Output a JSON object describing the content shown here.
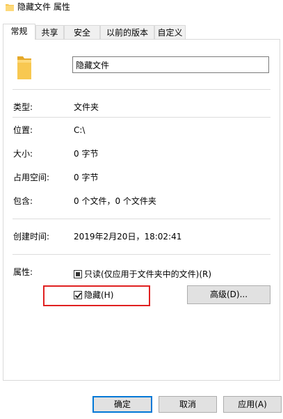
{
  "window": {
    "title": "隐藏文件 属性",
    "icon": "folder-icon",
    "folder_color": "#f8c851"
  },
  "tabs": [
    {
      "label": "常规",
      "active": true
    },
    {
      "label": "共享",
      "active": false
    },
    {
      "label": "安全",
      "active": false
    },
    {
      "label": "以前的版本",
      "active": false
    },
    {
      "label": "自定义",
      "active": false
    }
  ],
  "general": {
    "name_value": "隐藏文件",
    "type_label": "类型:",
    "type_value": "文件夹",
    "location_label": "位置:",
    "location_value": "C:\\",
    "size_label": "大小:",
    "size_value": "0 字节",
    "size_on_disk_label": "占用空间:",
    "size_on_disk_value": "0 字节",
    "contains_label": "包含:",
    "contains_value": "0 个文件，0 个文件夹",
    "created_label": "创建时间:",
    "created_value": "2019年2月20日，18:02:41",
    "attributes_label": "属性:",
    "readonly_label": "只读(仅应用于文件夹中的文件)(R)",
    "readonly_state": "indeterminate",
    "hidden_label": "隐藏(H)",
    "hidden_checked": true,
    "advanced_label": "高级(D)..."
  },
  "buttons": {
    "ok": "确定",
    "cancel": "取消",
    "apply": "应用(A)"
  },
  "accent_color": "#0078d7",
  "highlight_color": "#e02020"
}
